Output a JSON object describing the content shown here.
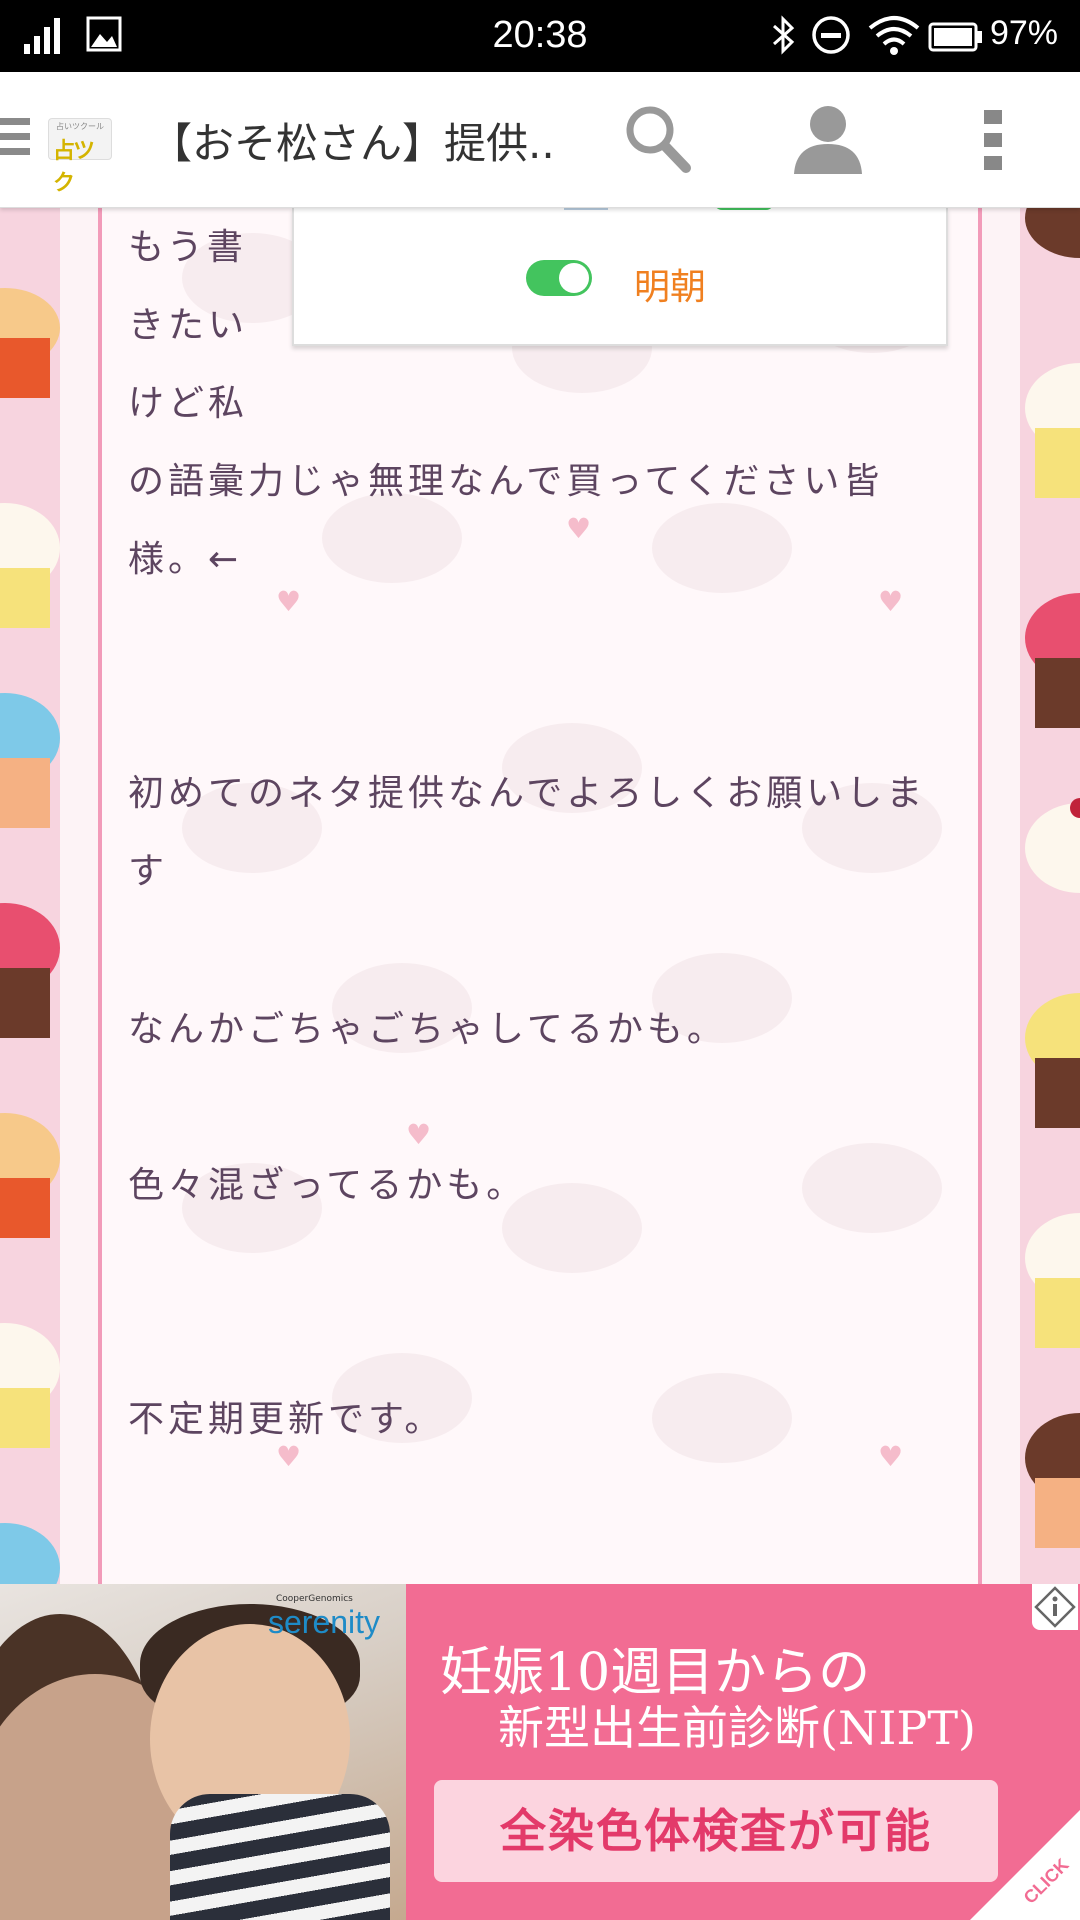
{
  "status_bar": {
    "time": "20:38",
    "battery": "97%"
  },
  "app_bar": {
    "logo_small": "占いツクール",
    "logo_main": "占ツク",
    "title": "【おそ松さん】提供.."
  },
  "font_toggle": {
    "label": "明朝",
    "state": "on"
  },
  "content": {
    "lines": [
      "もう書",
      "きたい",
      "けど私",
      "の語彙力じゃ無理なんで買ってください皆",
      "様。←",
      "初めてのネタ提供なんでよろしくお願いしま",
      "す",
      "なんかごちゃごちゃしてるかも。",
      "色々混ざってるかも。",
      "不定期更新です。"
    ]
  },
  "ad": {
    "brand_small": "CooperGenomics",
    "brand": "serenity",
    "headline1": "妊娠10週目からの",
    "headline2": "新型出生前診断(NIPT)",
    "cta": "全染色体検査が可能",
    "click_label": "CLICK"
  },
  "colors": {
    "accent_pink": "#f29bb9",
    "text": "#5d4560",
    "toggle_on": "#43c45e",
    "toggle_label": "#f08020",
    "ad_bg": "#f26c93"
  }
}
